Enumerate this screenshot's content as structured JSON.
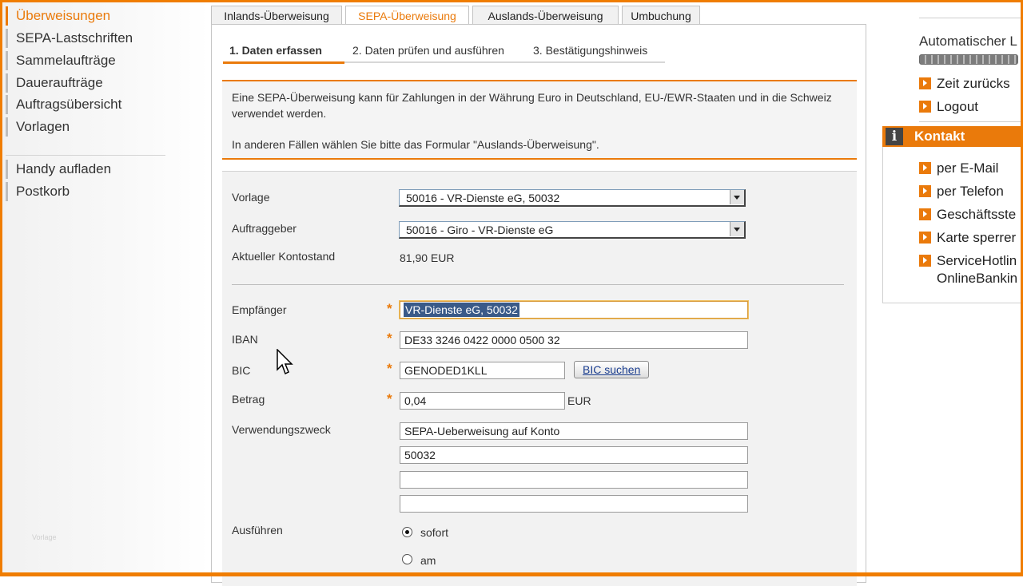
{
  "left_nav": {
    "items": [
      {
        "label": "Überweisungen",
        "active": true
      },
      {
        "label": "SEPA-Lastschriften"
      },
      {
        "label": "Sammelaufträge"
      },
      {
        "label": "Daueraufträge"
      },
      {
        "label": "Auftragsübersicht"
      },
      {
        "label": "Vorlagen"
      },
      {
        "label": "Handy aufladen"
      },
      {
        "label": "Postkorb"
      }
    ],
    "watermark": "Vorlage"
  },
  "tabs": [
    {
      "label": "Inlands-Überweisung"
    },
    {
      "label": "SEPA-Überweisung",
      "active": true
    },
    {
      "label": "Auslands-Überweisung"
    },
    {
      "label": "Umbuchung"
    }
  ],
  "steps": [
    {
      "label": "1. Daten erfassen",
      "active": true
    },
    {
      "label": "2. Daten prüfen und ausführen"
    },
    {
      "label": "3. Bestätigungshinweis"
    }
  ],
  "info": {
    "line1": "Eine SEPA-Überweisung kann für Zahlungen in der Währung Euro in Deutschland, EU-/EWR-Staaten und in die Schweiz verwendet werden.",
    "line2": "In anderen Fällen wählen Sie bitte das Formular \"Auslands-Überweisung\"."
  },
  "form": {
    "vorlage": {
      "label": "Vorlage",
      "value": "50016 - VR-Dienste eG, 50032"
    },
    "auftraggeber": {
      "label": "Auftraggeber",
      "value": "50016 - Giro - VR-Dienste eG"
    },
    "kontostand": {
      "label": "Aktueller Kontostand",
      "value": "81,90 EUR"
    },
    "empfaenger": {
      "label": "Empfänger",
      "value": "VR-Dienste eG, 50032"
    },
    "iban": {
      "label": "IBAN",
      "value": "DE33 3246 0422 0000 0500 32"
    },
    "bic": {
      "label": "BIC",
      "value": "GENODED1KLL",
      "search_label": "BIC suchen"
    },
    "betrag": {
      "label": "Betrag",
      "value": "0,04",
      "currency": "EUR"
    },
    "verwendungszweck": {
      "label": "Verwendungszweck",
      "lines": [
        "SEPA-Ueberweisung auf Konto",
        "50032",
        "",
        ""
      ]
    },
    "ausfuehren": {
      "label": "Ausführen",
      "options": [
        {
          "label": "sofort",
          "selected": true
        },
        {
          "label": "am",
          "selected": false
        }
      ]
    },
    "required_marker": "*"
  },
  "right": {
    "auto_logout_label": "Automatischer L",
    "links": [
      {
        "label": "Zeit zurücks"
      },
      {
        "label": "Logout"
      }
    ],
    "kontakt": {
      "title": "Kontakt",
      "icon": "info-icon",
      "items": [
        {
          "label": "per E-Mail"
        },
        {
          "label": "per Telefon"
        },
        {
          "label": "Geschäftsste"
        },
        {
          "label": "Karte sperrer"
        },
        {
          "label": "ServiceHotlin",
          "line2": "OnlineBankin"
        }
      ]
    }
  },
  "colors": {
    "accent": "#ea7a0b",
    "frame": "#f07d00"
  }
}
